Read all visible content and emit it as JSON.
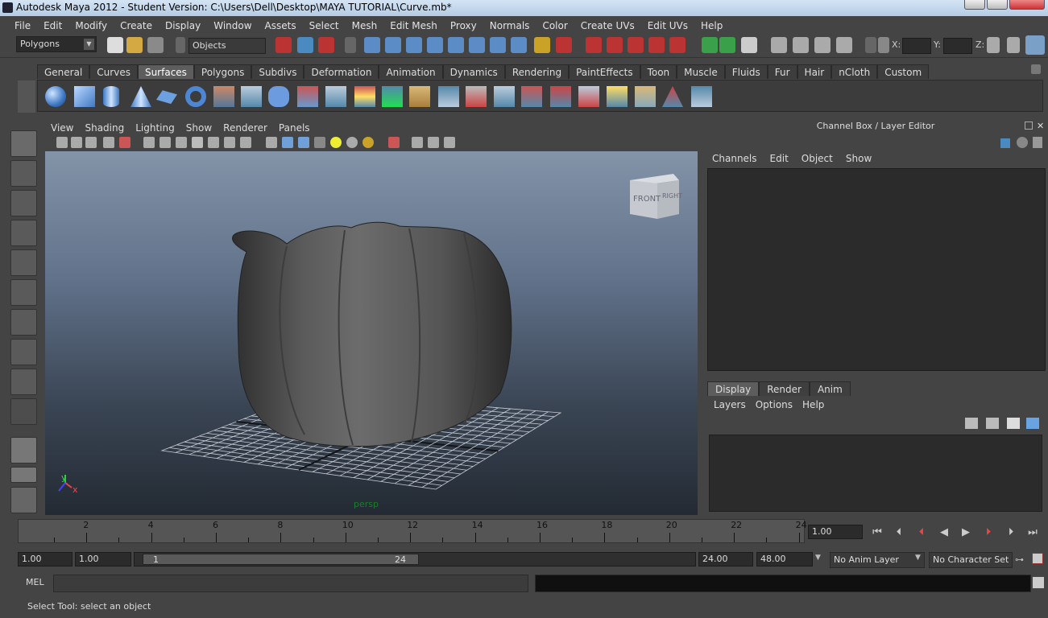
{
  "window": {
    "title": "Autodesk Maya 2012 - Student Version: C:\\Users\\Dell\\Desktop\\MAYA TUTORIAL\\Curve.mb*"
  },
  "menubar": [
    "File",
    "Edit",
    "Modify",
    "Create",
    "Display",
    "Window",
    "Assets",
    "Select",
    "Mesh",
    "Edit Mesh",
    "Proxy",
    "Normals",
    "Color",
    "Create UVs",
    "Edit UVs",
    "Help"
  ],
  "status": {
    "menuset": "Polygons",
    "selection_mode": "Objects",
    "x_label": "X:",
    "y_label": "Y:",
    "z_label": "Z:"
  },
  "shelf": {
    "tabs": [
      "General",
      "Curves",
      "Surfaces",
      "Polygons",
      "Subdivs",
      "Deformation",
      "Animation",
      "Dynamics",
      "Rendering",
      "PaintEffects",
      "Toon",
      "Muscle",
      "Fluids",
      "Fur",
      "Hair",
      "nCloth",
      "Custom"
    ],
    "active": "Surfaces"
  },
  "viewport": {
    "menu": [
      "View",
      "Shading",
      "Lighting",
      "Show",
      "Renderer",
      "Panels"
    ],
    "camera_label": "persp",
    "viewcube_front": "FRONT",
    "viewcube_right": "RIGHT",
    "axis_y": "y",
    "axis_x": "x"
  },
  "channel_box": {
    "title": "Channel Box / Layer Editor",
    "menu": [
      "Channels",
      "Edit",
      "Object",
      "Show"
    ]
  },
  "layer_editor": {
    "tabs": [
      "Display",
      "Render",
      "Anim"
    ],
    "active": "Display",
    "menu": [
      "Layers",
      "Options",
      "Help"
    ]
  },
  "timeline": {
    "ticks": [
      "2",
      "4",
      "6",
      "8",
      "10",
      "12",
      "14",
      "16",
      "18",
      "20",
      "22",
      "24"
    ],
    "current_time": "1.00"
  },
  "range": {
    "start_time": "1.00",
    "playback_start": "1.00",
    "range_start": "1",
    "range_end": "24",
    "playback_end": "24.00",
    "end_time": "48.00",
    "anim_layer": "No Anim Layer",
    "character_set": "No Character Set"
  },
  "mel": {
    "label": "MEL"
  },
  "help_line": "Select Tool: select an object"
}
